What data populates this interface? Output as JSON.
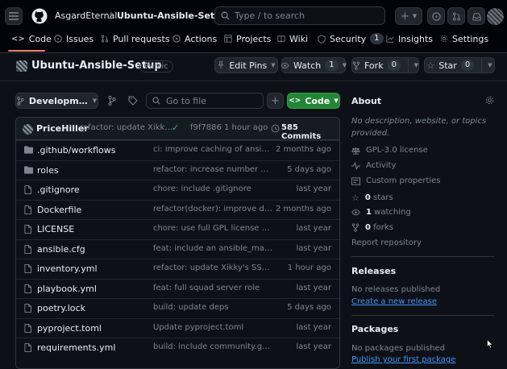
{
  "header": {
    "owner": "AsgardEternal",
    "separator": "/",
    "repo": "Ubuntu-Ansible-Setup",
    "search_placeholder": "Type / to search"
  },
  "tabs": [
    {
      "label": "Code",
      "icon": "code-icon",
      "count": ""
    },
    {
      "label": "Issues",
      "icon": "issue-icon",
      "count": ""
    },
    {
      "label": "Pull requests",
      "icon": "pull-request-icon",
      "count": ""
    },
    {
      "label": "Actions",
      "icon": "play-icon",
      "count": ""
    },
    {
      "label": "Projects",
      "icon": "table-icon",
      "count": ""
    },
    {
      "label": "Wiki",
      "icon": "book-icon",
      "count": ""
    },
    {
      "label": "Security",
      "icon": "shield-icon",
      "count": "1"
    },
    {
      "label": "Insights",
      "icon": "graph-icon",
      "count": ""
    },
    {
      "label": "Settings",
      "icon": "gear-icon",
      "count": ""
    }
  ],
  "repo_header": {
    "title": "Ubuntu-Ansible-Setup",
    "visibility": "Public",
    "edit_pins": "Edit Pins",
    "watch": "Watch",
    "watch_count": "1",
    "fork": "Fork",
    "fork_count": "0",
    "star": "Star",
    "star_count": "0"
  },
  "toolbar": {
    "branch": "Developm…",
    "goto_placeholder": "Go to file",
    "add": "+",
    "code": "Code"
  },
  "commit": {
    "author": "PriceHiller",
    "message": "refactor: update Xikk…",
    "hash": "f9f7886",
    "dot": "·",
    "time": "1 hour ago",
    "commits": "585 Commits"
  },
  "files": [
    {
      "type": "folder",
      "name": ".github/workflows",
      "message": "ci: improve caching of ansible i…",
      "time": "2 months ago"
    },
    {
      "type": "folder",
      "name": "roles",
      "message": "refactor: increase number of fa…",
      "time": "5 days ago"
    },
    {
      "type": "file",
      "name": ".gitignore",
      "message": "chore: include .gitignore",
      "time": "last year"
    },
    {
      "type": "file",
      "name": "Dockerfile",
      "message": "refactor(docker): improve dock…",
      "time": "2 months ago"
    },
    {
      "type": "file",
      "name": "LICENSE",
      "message": "chore: use full GPL license text,…",
      "time": "last year"
    },
    {
      "type": "file",
      "name": "ansible.cfg",
      "message": "feat: include an ansible_manag…",
      "time": "last year"
    },
    {
      "type": "file",
      "name": "inventory.yml",
      "message": "refactor: update Xikky's SSH key",
      "time": "1 hour ago"
    },
    {
      "type": "file",
      "name": "playbook.yml",
      "message": "feat: full squad server role",
      "time": "last year"
    },
    {
      "type": "file",
      "name": "poetry.lock",
      "message": "build: update deps",
      "time": "5 days ago"
    },
    {
      "type": "file",
      "name": "pyproject.toml",
      "message": "Update pyproject.toml",
      "time": "last year"
    },
    {
      "type": "file",
      "name": "requirements.yml",
      "message": "build: include community.gene…",
      "time": "last year"
    }
  ],
  "about": {
    "title": "About",
    "description": "No description, website, or topics provided.",
    "license": "GPL-3.0 license",
    "activity": "Activity",
    "custom_properties": "Custom properties",
    "stars_num": "0",
    "stars_label": "stars",
    "watching_num": "1",
    "watching_label": "watching",
    "forks_num": "0",
    "forks_label": "forks",
    "report": "Report repository"
  },
  "releases": {
    "title": "Releases",
    "empty": "No releases published",
    "create": "Create a new release"
  },
  "packages": {
    "title": "Packages",
    "empty": "No packages published",
    "publish": "Publish your first package"
  },
  "colors": {
    "accent": "#4493f8",
    "code_button": "#238636",
    "check": "#3fb950",
    "background": "#0d1117"
  }
}
